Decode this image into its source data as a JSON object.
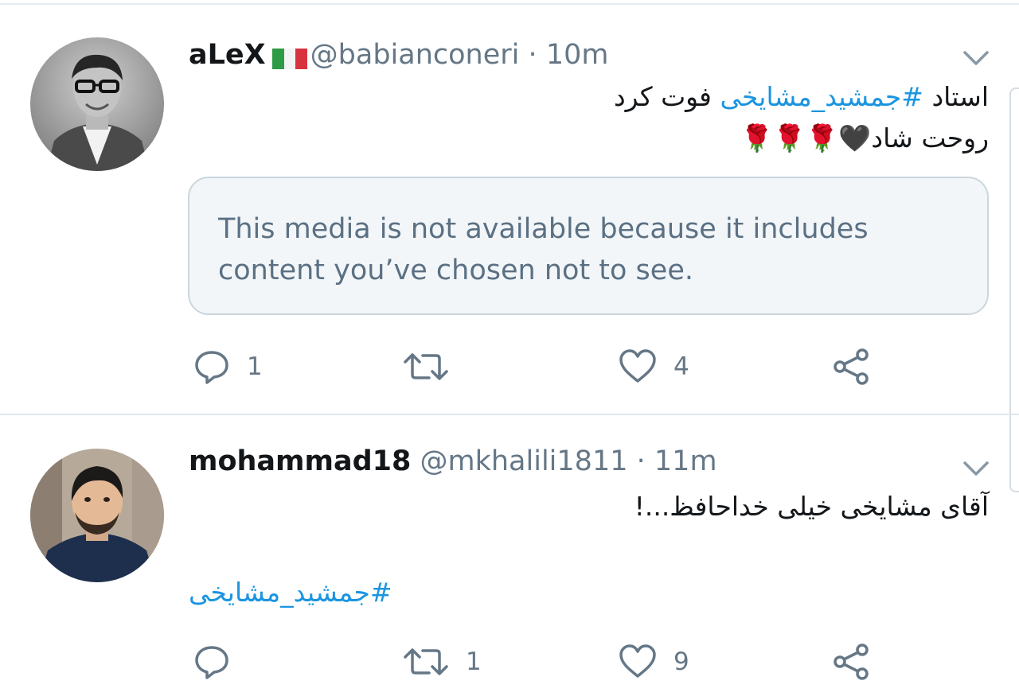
{
  "tweets": [
    {
      "display_name": "aLeX",
      "flag_icon": "italy-flag-icon",
      "handle": "@babianconeri",
      "separator": "·",
      "time": "10m",
      "text_before": "استاد ",
      "hashtag": "#جمشید_مشایخی",
      "text_after": " فوت کرد",
      "line2": "روحت شاد🖤🌹🌹🌹",
      "media_notice": "This media is not available because it includes content you’ve chosen not to see.",
      "reply_count": "1",
      "retweet_count": "",
      "like_count": "4"
    },
    {
      "display_name": "mohammad18",
      "handle": "@mkhalili1811",
      "separator": "·",
      "time": "11m",
      "text": "آقای مشایخی خیلی خداحافظ...!",
      "hashtag_line": "#جمشید_مشایخی",
      "reply_count": "",
      "retweet_count": "1",
      "like_count": "9"
    }
  ],
  "colors": {
    "accent": "#1b95e0",
    "secondary_text": "#657786",
    "icon": "#657786",
    "divider": "#e1e8ed",
    "media_bg": "#f2f6f9"
  },
  "icons": [
    "chevron-down-icon",
    "reply-icon",
    "retweet-icon",
    "like-icon",
    "share-icon"
  ]
}
